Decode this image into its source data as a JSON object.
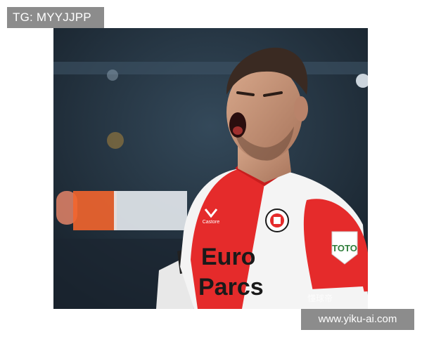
{
  "overlay": {
    "tag_text": "TG: MYYJJPP",
    "url_text": "www.yiku-ai.com",
    "corner_watermark": "懂球帝"
  },
  "photo": {
    "subject": "football player celebrating",
    "shirt_sponsor_line1": "Euro",
    "shirt_sponsor_line2": "Parcs",
    "kit_brand": "Castore",
    "sleeve_patch": "TOTO",
    "colors": {
      "shirt_red": "#e52b2b",
      "shirt_white": "#f4f4f4",
      "background_dark": "#1f2d3a",
      "board_orange": "#f2652e",
      "skin": "#c9977a",
      "hair": "#3a2a22"
    }
  }
}
